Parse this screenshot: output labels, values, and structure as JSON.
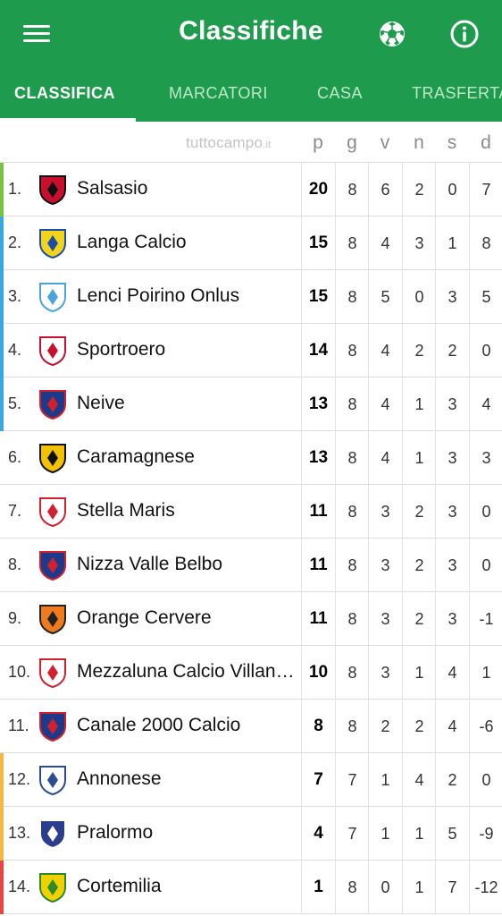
{
  "app": {
    "title": "Classifiche"
  },
  "tabs": [
    {
      "label": "CLASSIFICA",
      "active": true
    },
    {
      "label": "MARCATORI",
      "active": false
    },
    {
      "label": "CASA",
      "active": false
    },
    {
      "label": "TRASFERTA",
      "active": false
    }
  ],
  "table": {
    "brand": "tuttocampo",
    "brand_suffix": ".it",
    "columns": [
      "p",
      "g",
      "v",
      "n",
      "s",
      "d"
    ],
    "rows": [
      {
        "pos": "1.",
        "team": "Salsasio",
        "p": "20",
        "g": "8",
        "v": "6",
        "n": "2",
        "s": "0",
        "d": "7",
        "zone_color": "#7cc242"
      },
      {
        "pos": "2.",
        "team": "Langa Calcio",
        "p": "15",
        "g": "8",
        "v": "4",
        "n": "3",
        "s": "1",
        "d": "8",
        "zone_color": "#3aa7e0"
      },
      {
        "pos": "3.",
        "team": "Lenci Poirino Onlus",
        "p": "15",
        "g": "8",
        "v": "5",
        "n": "0",
        "s": "3",
        "d": "5",
        "zone_color": "#3aa7e0"
      },
      {
        "pos": "4.",
        "team": "Sportroero",
        "p": "14",
        "g": "8",
        "v": "4",
        "n": "2",
        "s": "2",
        "d": "0",
        "zone_color": "#3aa7e0"
      },
      {
        "pos": "5.",
        "team": "Neive",
        "p": "13",
        "g": "8",
        "v": "4",
        "n": "1",
        "s": "3",
        "d": "4",
        "zone_color": "#3aa7e0"
      },
      {
        "pos": "6.",
        "team": "Caramagnese",
        "p": "13",
        "g": "8",
        "v": "4",
        "n": "1",
        "s": "3",
        "d": "3",
        "zone_color": ""
      },
      {
        "pos": "7.",
        "team": "Stella Maris",
        "p": "11",
        "g": "8",
        "v": "3",
        "n": "2",
        "s": "3",
        "d": "0",
        "zone_color": ""
      },
      {
        "pos": "8.",
        "team": "Nizza Valle Belbo",
        "p": "11",
        "g": "8",
        "v": "3",
        "n": "2",
        "s": "3",
        "d": "0",
        "zone_color": ""
      },
      {
        "pos": "9.",
        "team": "Orange Cervere",
        "p": "11",
        "g": "8",
        "v": "3",
        "n": "2",
        "s": "3",
        "d": "-1",
        "zone_color": ""
      },
      {
        "pos": "10.",
        "team": "Mezzaluna Calcio Villanova",
        "p": "10",
        "g": "8",
        "v": "3",
        "n": "1",
        "s": "4",
        "d": "1",
        "zone_color": ""
      },
      {
        "pos": "11.",
        "team": "Canale 2000 Calcio",
        "p": "8",
        "g": "8",
        "v": "2",
        "n": "2",
        "s": "4",
        "d": "-6",
        "zone_color": ""
      },
      {
        "pos": "12.",
        "team": "Annonese",
        "p": "7",
        "g": "7",
        "v": "1",
        "n": "4",
        "s": "2",
        "d": "0",
        "zone_color": "#f5b841"
      },
      {
        "pos": "13.",
        "team": "Pralormo",
        "p": "4",
        "g": "7",
        "v": "1",
        "n": "1",
        "s": "5",
        "d": "-9",
        "zone_color": "#f5b841"
      },
      {
        "pos": "14.",
        "team": "Cortemilia",
        "p": "1",
        "g": "8",
        "v": "0",
        "n": "1",
        "s": "7",
        "d": "-12",
        "zone_color": "#e84545"
      }
    ]
  },
  "crests": [
    {
      "icon": "salsasio-crest-icon",
      "c1": "#c8102e",
      "c2": "#111111"
    },
    {
      "icon": "langa-crest-icon",
      "c1": "#f3d31c",
      "c2": "#1c4fa3"
    },
    {
      "icon": "lenci-crest-icon",
      "c1": "#ffffff",
      "c2": "#4aa3df"
    },
    {
      "icon": "sportroero-crest-icon",
      "c1": "#ffffff",
      "c2": "#c8102e"
    },
    {
      "icon": "neive-crest-icon",
      "c1": "#1d3a8a",
      "c2": "#d3202f"
    },
    {
      "icon": "caramagnese-crest-icon",
      "c1": "#f2c200",
      "c2": "#111111"
    },
    {
      "icon": "stella-maris-crest-icon",
      "c1": "#ffffff",
      "c2": "#d3202f"
    },
    {
      "icon": "nizza-crest-icon",
      "c1": "#1d3a8a",
      "c2": "#d3202f"
    },
    {
      "icon": "orange-cervere-crest-icon",
      "c1": "#f07b1e",
      "c2": "#222222"
    },
    {
      "icon": "mezzaluna-crest-icon",
      "c1": "#ffffff",
      "c2": "#d3202f"
    },
    {
      "icon": "canale-crest-icon",
      "c1": "#1d3a8a",
      "c2": "#d3202f"
    },
    {
      "icon": "annonese-crest-icon",
      "c1": "#ffffff",
      "c2": "#2a4d8f"
    },
    {
      "icon": "pralormo-crest-icon",
      "c1": "#2a3d8f",
      "c2": "#ffffff"
    },
    {
      "icon": "cortemilia-crest-icon",
      "c1": "#f2d100",
      "c2": "#2c8a2c"
    }
  ],
  "colors": {
    "header_green": "#1e9b4c",
    "zone_promotion": "#7cc242",
    "zone_playoff": "#3aa7e0",
    "zone_playout": "#f5b841",
    "zone_relegation": "#e84545"
  }
}
